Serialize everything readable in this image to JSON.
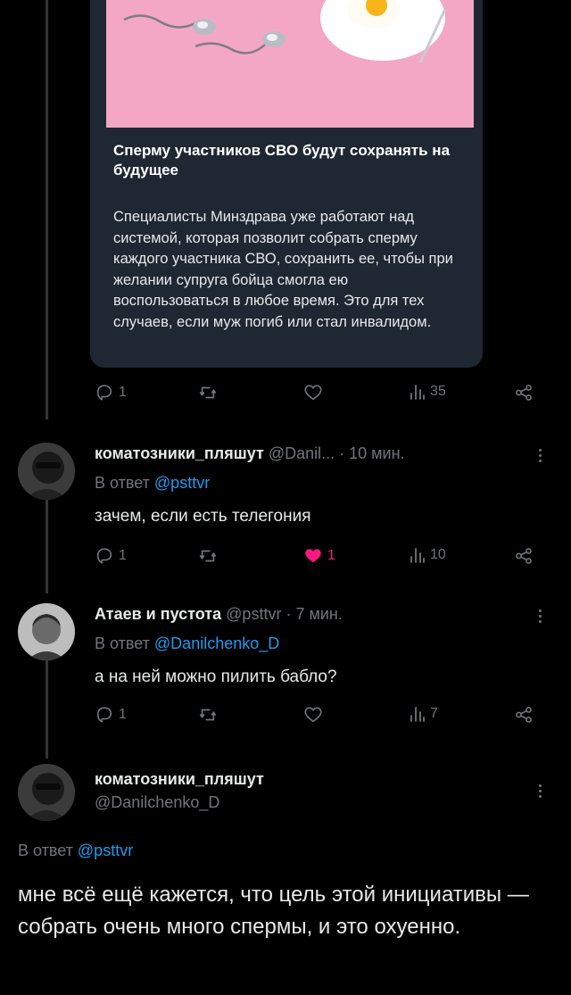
{
  "quoted_card": {
    "title": "Сперму участников СВО будут сохранять на будущее",
    "body": "Специалисты Минздрава уже работают над системой, которая позволит собрать сперму каждого участника СВО, сохранить ее, чтобы при желании супруга бойца смогла ею воспользоваться в любое время. Это для тех случаев, если муж погиб или стал инвалидом."
  },
  "post_actions": {
    "replies": "1",
    "views": "35"
  },
  "reply1": {
    "name": "коматозники_пляшут",
    "handle": "@Danil...",
    "time": "· 10 мин.",
    "reply_prefix": "В ответ",
    "reply_to": "@psttvr",
    "text": "зачем, если есть телегония",
    "replies": "1",
    "likes": "1",
    "views": "10"
  },
  "reply2": {
    "name": "Атаев и пустота",
    "handle": "@psttvr",
    "time": "· 7 мин.",
    "reply_prefix": "В ответ",
    "reply_to": "@Danilchenko_D",
    "text": "а на ней можно пилить бабло?",
    "replies": "1",
    "views": "7"
  },
  "main": {
    "name": "коматозники_пляшут",
    "handle": "@Danilchenko_D",
    "reply_prefix": "В ответ",
    "reply_to": "@psttvr",
    "text": "мне всё ещё кажется, что цель этой инициативы — собрать очень много спермы, и это охуенно."
  },
  "colors": {
    "accent": "#1d9bf0",
    "like": "#f91880",
    "muted": "#71767b"
  }
}
